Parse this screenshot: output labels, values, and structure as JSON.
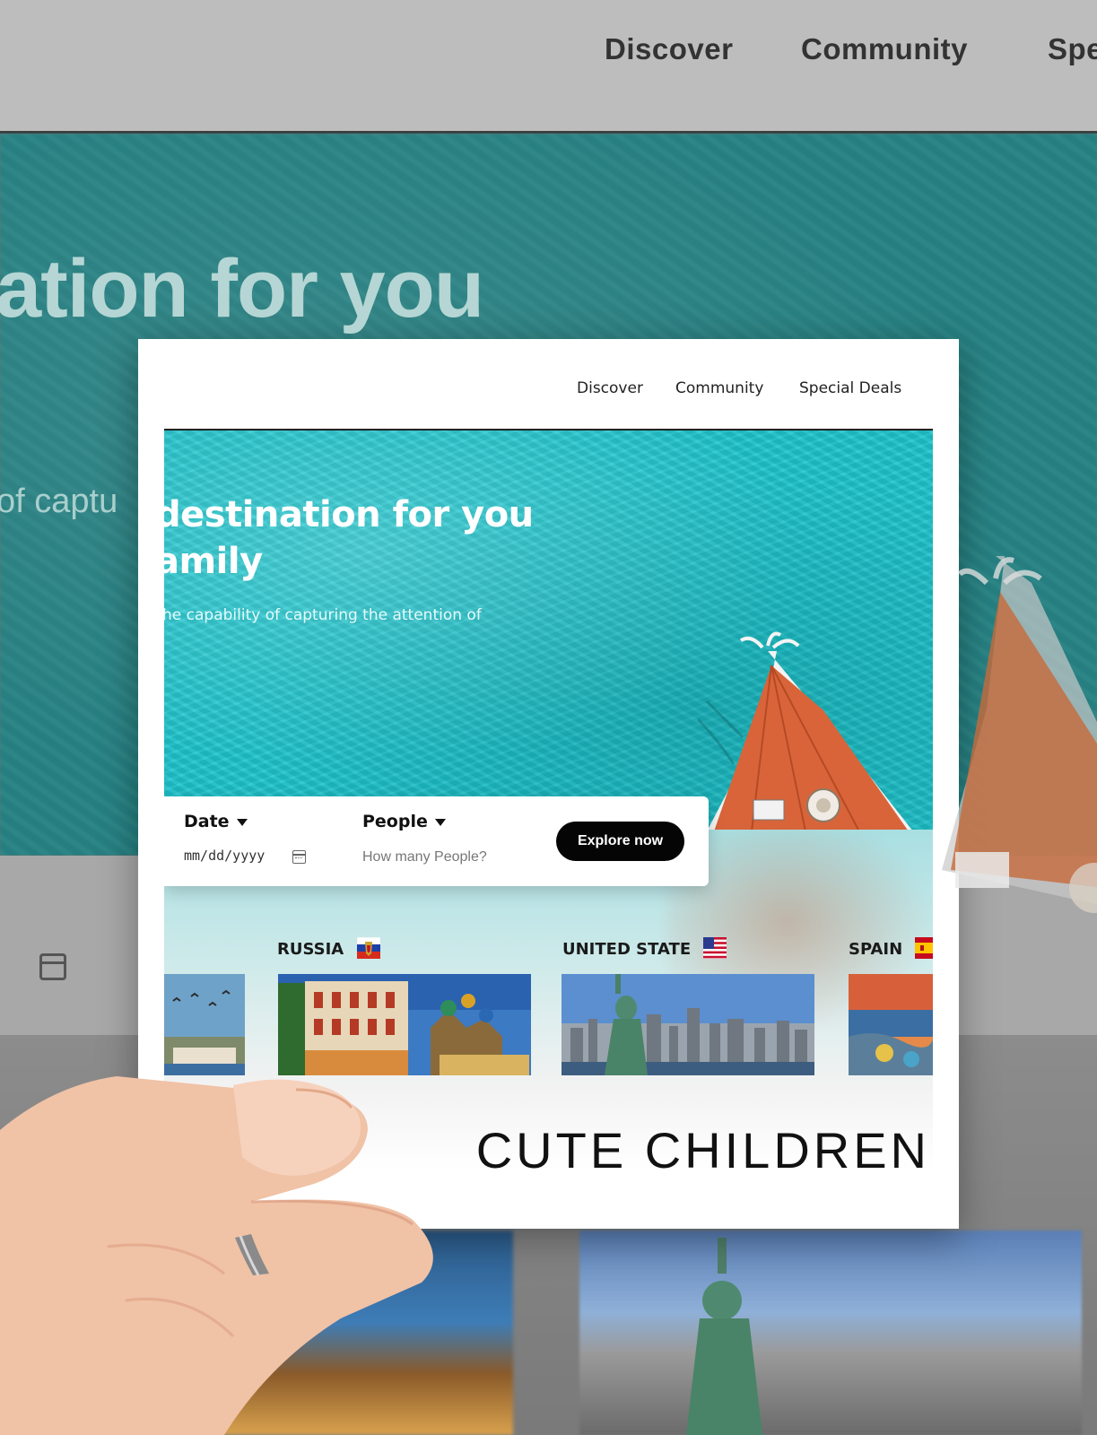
{
  "background": {
    "nav": [
      "Discover",
      "Community",
      "Spe"
    ],
    "hero_title": "ation for you",
    "hero_subtitle": "of captu"
  },
  "card": {
    "nav": [
      "Discover",
      "Community",
      "Special Deals"
    ],
    "hero": {
      "title_line1": "destination for you",
      "title_line2": "amily",
      "subtitle": "he capability of capturing the attention of"
    },
    "search": {
      "date_label": "Date",
      "date_placeholder": "mm/dd/yyyy",
      "people_label": "People",
      "people_placeholder": "How many People?",
      "button_label": "Explore now"
    },
    "destinations": [
      {
        "name": "RUSSIA",
        "flag": "russia-flag-icon"
      },
      {
        "name": "UNITED STATE",
        "flag": "usa-flag-icon"
      },
      {
        "name": "SPAIN",
        "flag": "spain-flag-icon"
      }
    ],
    "caption": "CUTE CHILDREN"
  },
  "colors": {
    "water": "#1ec4cc",
    "button": "#050505",
    "boat": "#d9643a"
  }
}
